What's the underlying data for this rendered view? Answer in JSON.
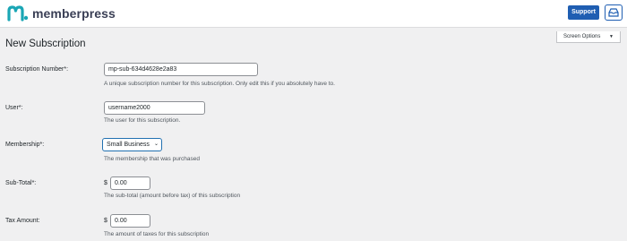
{
  "header": {
    "brand": "memberpress",
    "support_label": "Support",
    "brand_color": "#1f5eb2"
  },
  "screen_options": {
    "label": "Screen Options",
    "arrow": "▼"
  },
  "page": {
    "title": "New Subscription"
  },
  "form": {
    "subscription_number": {
      "label": "Subscription Number*:",
      "value": "mp-sub-634d4628e2a83",
      "description": "A unique subscription number for this subscription. Only edit this if you absolutely have to."
    },
    "user": {
      "label": "User*:",
      "value": "username2000",
      "description": "The user for this subscription."
    },
    "membership": {
      "label": "Membership*:",
      "value": "Small Business",
      "description": "The membership that was purchased"
    },
    "subtotal": {
      "label": "Sub-Total*:",
      "currency": "$",
      "value": "0.00",
      "description": "The sub-total (amount before tax) of this subscription"
    },
    "tax_amount": {
      "label": "Tax Amount:",
      "currency": "$",
      "value": "0.00",
      "description": "The amount of taxes for this subscription"
    }
  }
}
